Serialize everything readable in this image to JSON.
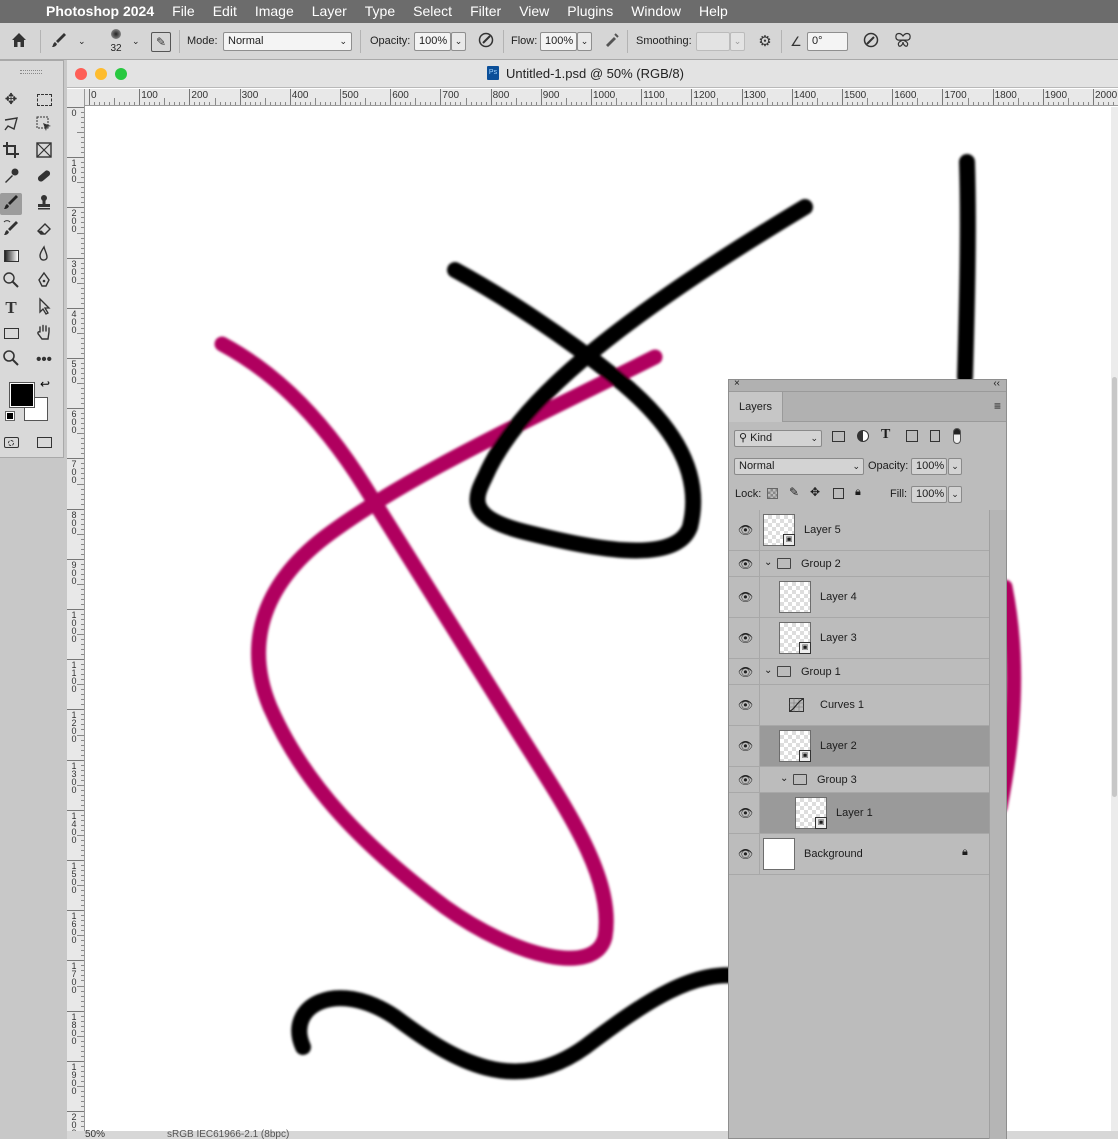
{
  "menubar": {
    "apple": "",
    "items": [
      "Photoshop 2024",
      "File",
      "Edit",
      "Image",
      "Layer",
      "Type",
      "Select",
      "Filter",
      "View",
      "Plugins",
      "Window",
      "Help"
    ]
  },
  "options": {
    "brush_size": "32",
    "mode_label": "Mode:",
    "mode_value": "Normal",
    "opacity_label": "Opacity:",
    "opacity_value": "100%",
    "flow_label": "Flow:",
    "flow_value": "100%",
    "smoothing_label": "Smoothing:",
    "smoothing_value": "",
    "angle_value": "0°"
  },
  "document": {
    "title": "Untitled-1.psd @ 50% (RGB/8)",
    "status": "50%",
    "status_info": "sRGB IEC61966-2.1 (8bpc)"
  },
  "ruler": {
    "h_labels": [
      "0",
      "100",
      "200",
      "300",
      "400",
      "500",
      "600",
      "700",
      "800",
      "900",
      "1000",
      "1100",
      "1200",
      "1300",
      "1400",
      "1500",
      "1600",
      "1700",
      "1800",
      "1900",
      "2000"
    ],
    "v_labels": [
      "0",
      "100",
      "200",
      "300",
      "400",
      "500",
      "600",
      "700",
      "800",
      "900",
      "1000",
      "1100",
      "1200",
      "1300",
      "1400",
      "1500",
      "1600",
      "1700",
      "1800",
      "1900",
      "2000"
    ]
  },
  "colors": {
    "foreground": "#000000",
    "background": "#ffffff",
    "stroke_magenta": "#b0005e",
    "stroke_black": "#000000"
  },
  "layers_panel": {
    "tab": "Layers",
    "kind_label": "Kind",
    "blend_mode": "Normal",
    "opacity_label": "Opacity:",
    "opacity_value": "100%",
    "lock_label": "Lock:",
    "fill_label": "Fill:",
    "fill_value": "100%",
    "layers": [
      {
        "name": "Layer 5",
        "kind": "smart",
        "indent": 0,
        "selected": false
      },
      {
        "name": "Group 2",
        "kind": "group",
        "indent": 0,
        "selected": false
      },
      {
        "name": "Layer 4",
        "kind": "pixel",
        "indent": 1,
        "selected": false
      },
      {
        "name": "Layer 3",
        "kind": "smart",
        "indent": 1,
        "selected": false
      },
      {
        "name": "Group 1",
        "kind": "group",
        "indent": 0,
        "selected": false
      },
      {
        "name": "Curves 1",
        "kind": "adjustment",
        "indent": 1,
        "selected": false
      },
      {
        "name": "Layer 2",
        "kind": "smart",
        "indent": 1,
        "selected": true
      },
      {
        "name": "Group 3",
        "kind": "group",
        "indent": 1,
        "selected": false
      },
      {
        "name": "Layer 1",
        "kind": "smart",
        "indent": 2,
        "selected": true
      },
      {
        "name": "Background",
        "kind": "background",
        "indent": 0,
        "selected": false
      }
    ]
  }
}
